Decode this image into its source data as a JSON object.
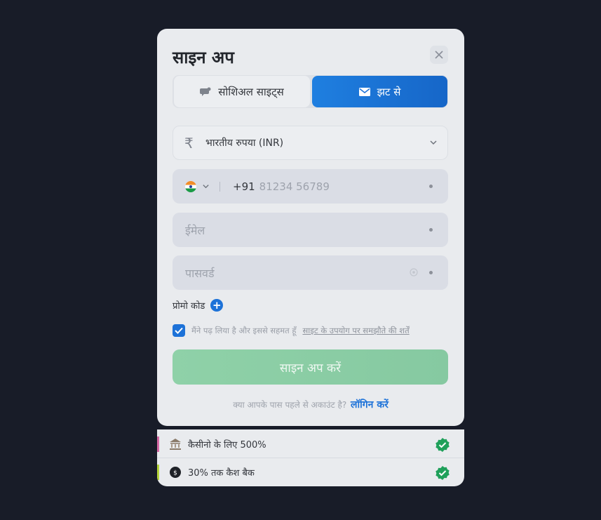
{
  "modal": {
    "title": "साइन अप",
    "close_icon": "close-icon"
  },
  "tabs": [
    {
      "label": "सोशिअल साइट्स",
      "icon": "chat-bubble-icon",
      "active": false
    },
    {
      "label": "झट से",
      "icon": "envelope-icon",
      "active": true
    }
  ],
  "currency": {
    "symbol": "₹",
    "value": "भारतीय रुपया (INR)"
  },
  "phone": {
    "country_code": "+91",
    "placeholder": "81234 56789",
    "flag": "india-flag-icon"
  },
  "email": {
    "placeholder": "ईमेल"
  },
  "password": {
    "placeholder": "पासवर्ड"
  },
  "promo": {
    "label": "प्रोमो कोड",
    "icon": "+"
  },
  "agreement": {
    "text": "मैंने पढ़ लिया है और इससे सहमत हूँ",
    "link": "साइट के उपयोग पर समझौते की शर्तें",
    "checked": true
  },
  "submit": {
    "label": "साइन अप करें"
  },
  "login": {
    "question": "क्या आपके पास पहले से अकाउंट है?",
    "link": "लॉगिन करें"
  },
  "bonuses": [
    {
      "text": "कैसीनो के लिए 500%",
      "icon": "casino-building-icon",
      "accent": "#d66aa6"
    },
    {
      "text": "30% तक कैश बैक",
      "icon": "cashback-coin-icon",
      "accent": "#b5d43a"
    }
  ],
  "colors": {
    "primary": "#1d72d8",
    "success": "#1fa05a",
    "submit": "#8fd1a8",
    "background": "#181c28"
  }
}
